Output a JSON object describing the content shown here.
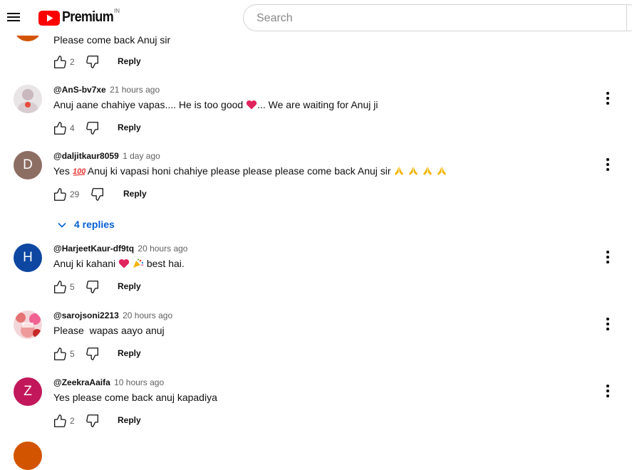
{
  "header": {
    "logo_text": "Premium",
    "logo_region": "IN",
    "search_placeholder": "Search",
    "brand_color": "#ff0000"
  },
  "comments": [
    {
      "author": "",
      "time": "",
      "text": "Please come back Anuj sir",
      "likes": "2",
      "reply_label": "Reply"
    },
    {
      "author": "@AnS-bv7xe",
      "time": "21 hours ago",
      "text_before": "Anuj aane chahiye vapas.... He is too good",
      "text_after": "... We are waiting for Anuj ji",
      "emojis": [
        "red-heart"
      ],
      "likes": "4",
      "reply_label": "Reply"
    },
    {
      "author": "@daljitkaur8059",
      "time": "1 day ago",
      "avatar_letter": "D",
      "avatar_color": "#8d6e63",
      "text_before": "Yes",
      "text_after": "Anuj ki vapasi honi chahiye please please please come back Anuj sir",
      "emojis": [
        "hundred-points",
        "folded-hands",
        "folded-hands",
        "folded-hands",
        "folded-hands"
      ],
      "likes": "29",
      "reply_label": "Reply",
      "replies_label": "4 replies"
    },
    {
      "author": "@HarjeetKaur-df9tq",
      "time": "20 hours ago",
      "avatar_letter": "H",
      "avatar_color": "#0d47a1",
      "text_before": "Anuj ki kahani",
      "text_after": "best hai.",
      "emojis": [
        "red-heart",
        "party-popper"
      ],
      "likes": "5",
      "reply_label": "Reply"
    },
    {
      "author": "@sarojsoni2213",
      "time": "20 hours ago",
      "text": "Please  wapas aayo anuj",
      "likes": "5",
      "reply_label": "Reply"
    },
    {
      "author": "@ZeekraAaifa",
      "time": "10 hours ago",
      "avatar_letter": "Z",
      "avatar_color": "#c2185b",
      "text": "Yes please come back anuj kapadiya",
      "likes": "2",
      "reply_label": "Reply"
    }
  ]
}
